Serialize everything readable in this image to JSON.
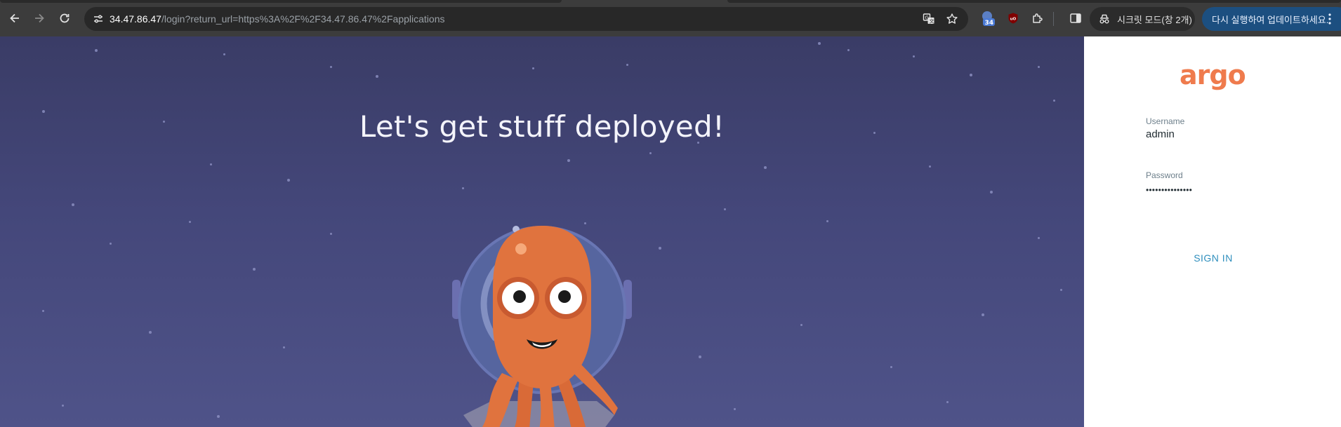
{
  "browser": {
    "url_host": "34.47.86.47",
    "url_path": "/login?return_url=https%3A%2F%2F34.47.86.47%2Fapplications",
    "extension_badge": "34",
    "ublock_label": "uO",
    "incognito_label": "시크릿 모드(창 2개)",
    "update_label": "다시 실행하여 업데이트하세요.",
    "icons": [
      "back-icon",
      "forward-icon",
      "reload-icon",
      "site-info-icon",
      "translate-icon",
      "bookmark-star-icon",
      "extension-icon",
      "ublock-icon",
      "extensions-puzzle-icon",
      "side-panel-icon",
      "incognito-icon",
      "more-icon"
    ]
  },
  "hero": {
    "title": "Let's get stuff deployed!"
  },
  "login": {
    "logo_text": "argo",
    "username_label": "Username",
    "username_value": "admin",
    "password_label": "Password",
    "password_value": "•••••••••••••••",
    "signin_label": "SIGN IN"
  },
  "colors": {
    "chrome_bar": "#3c3c3c",
    "omnibox": "#282828",
    "update_pill": "#1c4f80",
    "hero_top": "#3a3c66",
    "hero_bottom": "#4f5389",
    "argo_orange": "#ef7b4d",
    "signin_blue": "#2f8fbd"
  }
}
